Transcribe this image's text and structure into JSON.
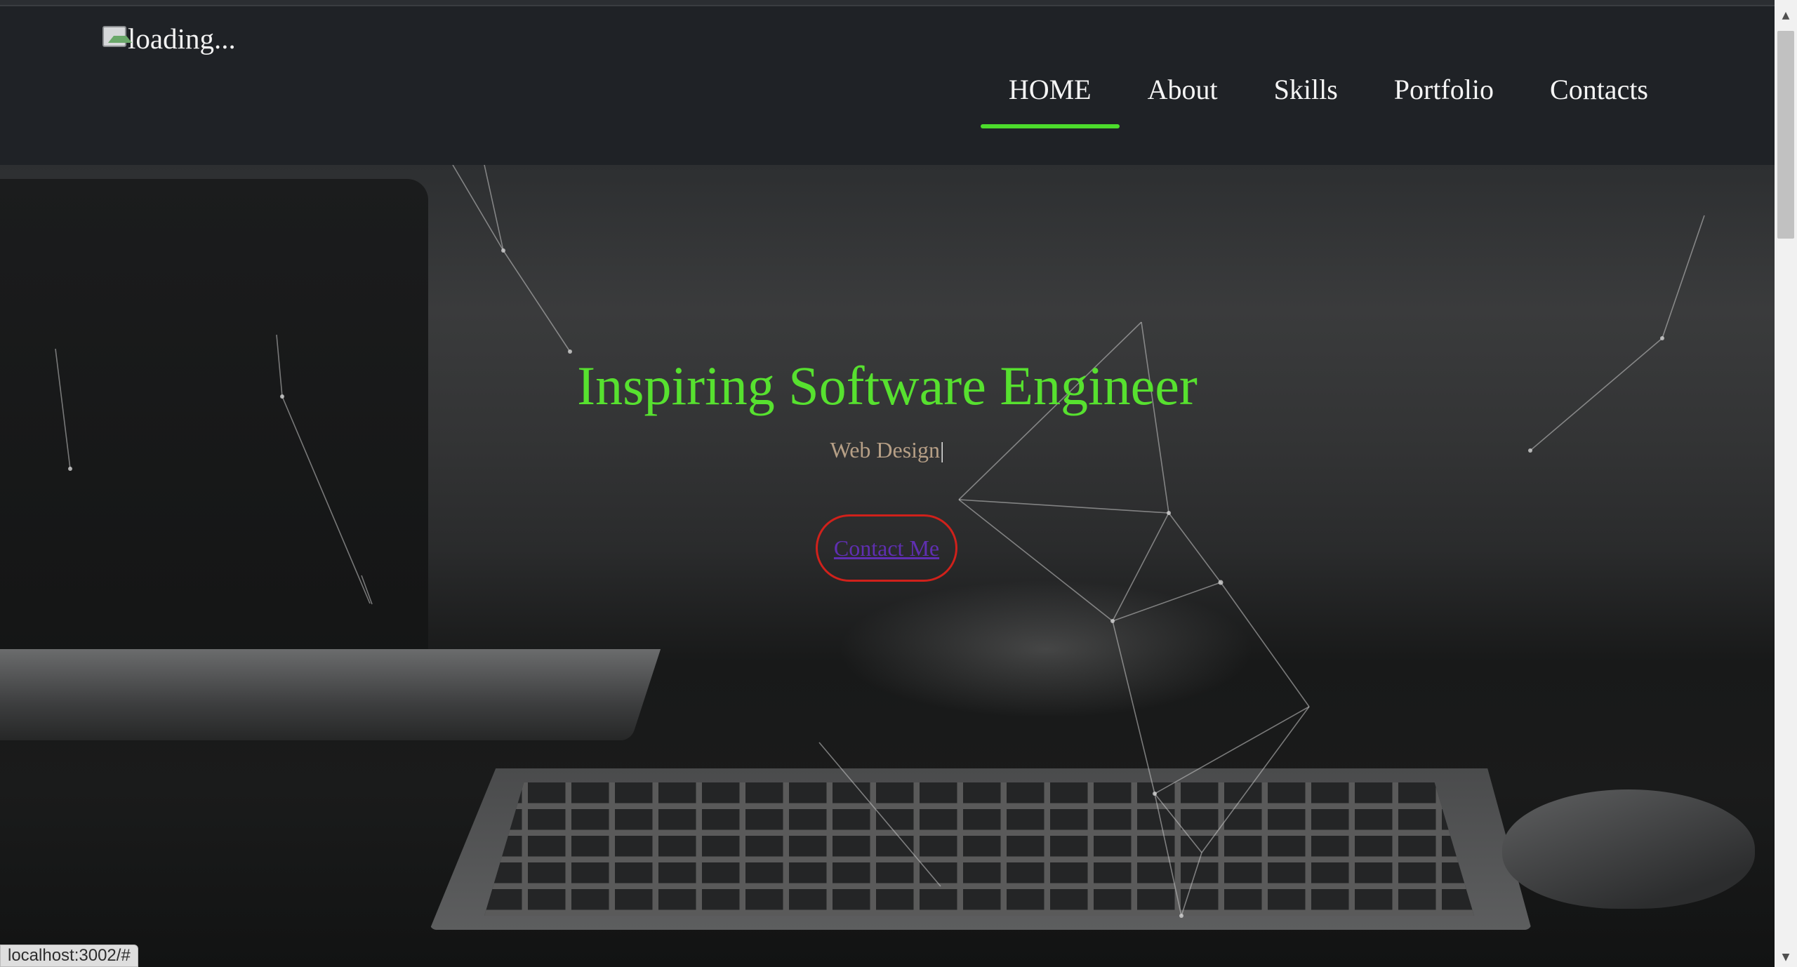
{
  "header": {
    "logo_alt": "loading...",
    "nav": [
      {
        "label": "HOME",
        "active": true
      },
      {
        "label": "About",
        "active": false
      },
      {
        "label": "Skills",
        "active": false
      },
      {
        "label": "Portfolio",
        "active": false
      },
      {
        "label": "Contacts",
        "active": false
      }
    ]
  },
  "hero": {
    "title": "Inspiring Software Engineer",
    "subtitle": "Web Design",
    "typing_cursor": "|",
    "cta_label": "Contact Me"
  },
  "status_bar": {
    "url": "localhost:3002/#"
  },
  "colors": {
    "accent_green": "#57e12f",
    "nav_underline": "#4cdc2c",
    "cta_border": "#d0211b",
    "cta_text": "#5f2fb1",
    "subtitle": "#b69f86"
  },
  "icons": {
    "logo": "broken-image-icon",
    "scroll_up": "chevron-up-icon",
    "scroll_down": "chevron-down-icon"
  }
}
